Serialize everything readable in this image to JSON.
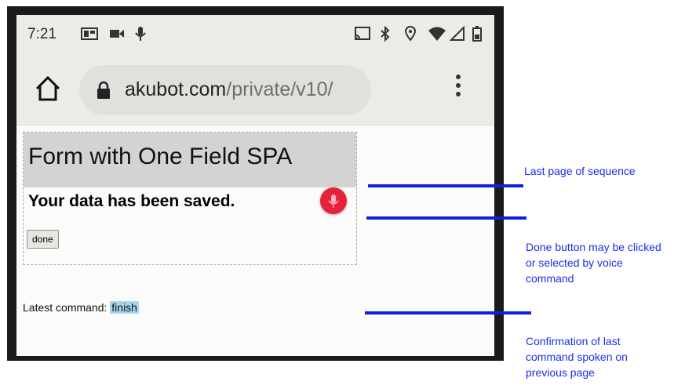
{
  "status_bar": {
    "time": "7:21",
    "left_icons": [
      "tv-notification-icon",
      "video-camera-icon",
      "microphone-icon"
    ],
    "right_icons": [
      "cast-icon",
      "bluetooth-icon",
      "location-icon",
      "wifi-icon",
      "signal-icon",
      "battery-icon"
    ]
  },
  "browser": {
    "url_domain": "akubot.com",
    "url_path": "/private/v10/",
    "menu_icon": "three-dot-menu-icon"
  },
  "page": {
    "title": "Form with One Field SPA",
    "message": "Your data has been saved.",
    "done_button": "done",
    "latest_label": "Latest command: ",
    "latest_value": "finish"
  },
  "annotations": [
    {
      "text": "Last page of sequence"
    },
    {
      "text": "Done button may be clicked or selected by voice command"
    },
    {
      "text": "Confirmation of last command spoken on previous page"
    }
  ],
  "colors": {
    "annotation": "#1a2fe8",
    "mic_button": "#e8213a",
    "command_highlight": "#a7d5ee"
  }
}
